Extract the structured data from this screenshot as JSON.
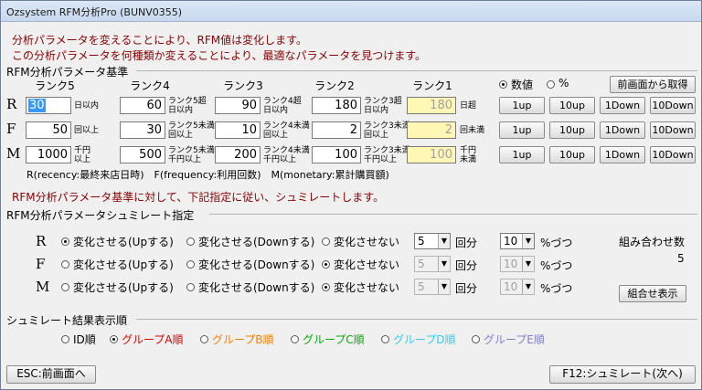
{
  "window": {
    "title": "Ozsystem RFM分析Pro (BUNV0355)"
  },
  "messages": {
    "line1": "分析パラメータを変えることにより、RFM値は変化します。",
    "line2": "この分析パラメータを何種類か変えることにより、最適なパラメータを見つけます。",
    "line3": "RFM分析パラメータ基準に対して、下記指定に従い、シュミレートします。"
  },
  "params": {
    "group_title": "RFM分析パラメータ基準",
    "rank_headers": [
      "ランク5",
      "ランク4",
      "ランク3",
      "ランク2",
      "ランク1"
    ],
    "mode_options": [
      "数値",
      "%"
    ],
    "mode_selected": "数値",
    "fetch_button": "前画面から取得",
    "rows": [
      {
        "label": "R",
        "values": [
          "30",
          "60",
          "90",
          "180",
          "180"
        ],
        "units": [
          "日以内",
          "ランク5超\n日以内",
          "ランク4超\n日以内",
          "ランク3超\n日以内",
          "日超"
        ]
      },
      {
        "label": "F",
        "values": [
          "50",
          "30",
          "10",
          "2",
          "2"
        ],
        "units": [
          "回以上",
          "ランク5未満\n回以上",
          "ランク4未満\n回以上",
          "ランク3未満\n回以上",
          "回未満"
        ]
      },
      {
        "label": "M",
        "values": [
          "1000",
          "500",
          "200",
          "100",
          "100"
        ],
        "units": [
          "千円\n以上",
          "ランク5未満\n千円以上",
          "ランク4未満\n千円以上",
          "ランク3未満\n千円以上",
          "千円\n未満"
        ]
      }
    ],
    "step_buttons": [
      "1up",
      "10up",
      "1Down",
      "10Down"
    ],
    "legend": "R(recency:最終来店日時)　F(frequency:利用回数)　M(monetary:累計購買額)"
  },
  "simulate": {
    "group_title": "RFM分析パラメータシュミレート指定",
    "options": [
      "変化させる(Upする)",
      "変化させる(Downする)",
      "変化させない"
    ],
    "rows": [
      {
        "label": "R",
        "selected": 0,
        "count": "5",
        "step": "10",
        "enabled": true
      },
      {
        "label": "F",
        "selected": 2,
        "count": "5",
        "step": "10",
        "enabled": false
      },
      {
        "label": "M",
        "selected": 2,
        "count": "5",
        "step": "10",
        "enabled": false
      }
    ],
    "count_suffix": "回分",
    "step_suffix": "%づつ",
    "combo_label": "組み合わせ数",
    "combo_count": "5",
    "combo_button": "組合せ表示"
  },
  "order": {
    "group_title": "シュミレート結果表示順",
    "options": [
      {
        "label": "ID順",
        "color": "#000000"
      },
      {
        "label": "グループA順",
        "color": "#e00000"
      },
      {
        "label": "グループB順",
        "color": "#f08000"
      },
      {
        "label": "グループC順",
        "color": "#00b000"
      },
      {
        "label": "グループD順",
        "color": "#33ccee"
      },
      {
        "label": "グループE順",
        "color": "#8080cc"
      }
    ],
    "selected": 1
  },
  "footer": {
    "esc_button": "ESC:前画面へ",
    "f12_button": "F12:シュミレート(次へ)"
  }
}
